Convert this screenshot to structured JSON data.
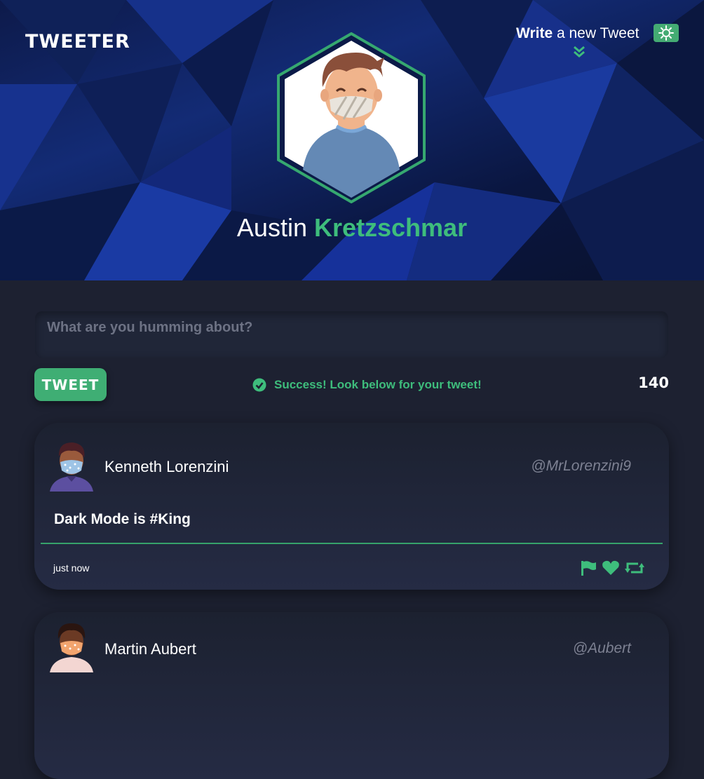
{
  "header": {
    "brand": "TWEETER",
    "write_bold": "Write",
    "write_rest": " a new Tweet",
    "profile_first": "Austin",
    "profile_last": "Kretzschmar"
  },
  "composer": {
    "placeholder": "What are you humming about?",
    "value": "",
    "tweet_button": "TWEET",
    "status": "Success! Look below for your tweet!",
    "char_count": "140"
  },
  "tweets": [
    {
      "name": "Kenneth Lorenzini",
      "handle": "@MrLorenzini9",
      "content": "Dark Mode is #King",
      "time": "just now"
    },
    {
      "name": "Martin Aubert",
      "handle": "@Aubert",
      "content": "",
      "time": ""
    }
  ],
  "colors": {
    "accent": "#3ebd7c",
    "background": "#1d2131",
    "card": "#222840",
    "header_blue": "#132b75"
  },
  "icons": {
    "theme_toggle": "sun-icon",
    "write_indicator": "double-chevron-down-icon",
    "status": "check-circle-icon",
    "actions": [
      "flag-icon",
      "heart-icon",
      "retweet-icon"
    ]
  }
}
